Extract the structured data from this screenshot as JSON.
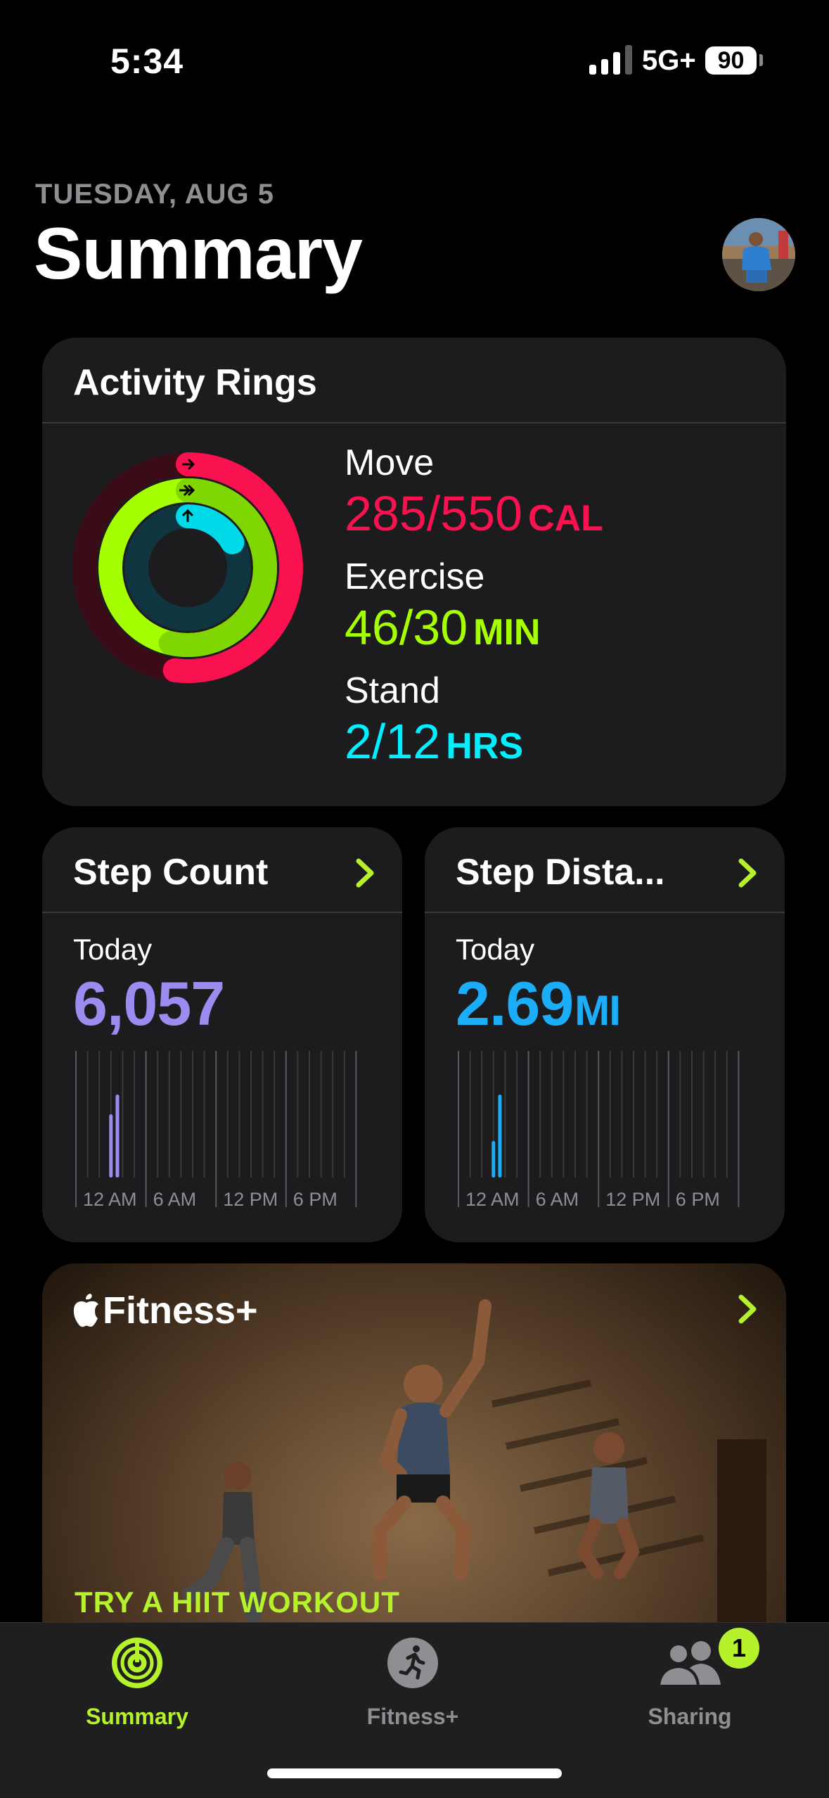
{
  "status_bar": {
    "time": "5:34",
    "network": "5G+",
    "battery": "90"
  },
  "header": {
    "date": "TUESDAY, AUG 5",
    "title": "Summary"
  },
  "activity_rings": {
    "title": "Activity Rings",
    "move": {
      "label": "Move",
      "value": "285/550",
      "unit": "CAL",
      "color": "#fa114f"
    },
    "exercise": {
      "label": "Exercise",
      "value": "46/30",
      "unit": "MIN",
      "color": "#a6ff00"
    },
    "stand": {
      "label": "Stand",
      "value": "2/12",
      "unit": "HRS",
      "color": "#00f0ff"
    }
  },
  "step_count": {
    "title": "Step Count",
    "today_label": "Today",
    "value": "6,057",
    "color": "#9d8bf0",
    "axis_labels": [
      "12 AM",
      "6 AM",
      "12 PM",
      "6 PM"
    ]
  },
  "step_distance": {
    "title": "Step Dista...",
    "today_label": "Today",
    "value": "2.69",
    "unit": "MI",
    "color": "#1badf8",
    "axis_labels": [
      "12 AM",
      "6 AM",
      "12 PM",
      "6 PM"
    ]
  },
  "fitness_plus": {
    "title": "Fitness+",
    "cta": "TRY A HIIT WORKOUT"
  },
  "tab_bar": {
    "tabs": [
      {
        "label": "Summary",
        "active": true
      },
      {
        "label": "Fitness+",
        "active": false
      },
      {
        "label": "Sharing",
        "active": false
      }
    ],
    "sharing_badge": "1"
  },
  "colors": {
    "accent": "#b6f22c",
    "card": "#1c1c1e",
    "secondary_text": "#8e8e93"
  }
}
